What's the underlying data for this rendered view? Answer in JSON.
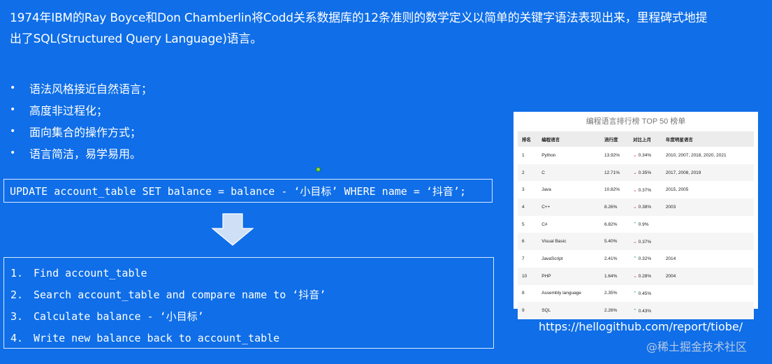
{
  "intro": {
    "line1": "1974年IBM的Ray Boyce和Don Chamberlin将Codd关系数据库的12条准则的数学定义以简单的关键字语法表现出来，里程碑式地提",
    "line2": "出了SQL(Structured Query Language)语言。"
  },
  "bullets": [
    "语法风格接近自然语言；",
    "高度非过程化；",
    "面向集合的操作方式；",
    "语言简洁，易学易用。"
  ],
  "sql_statement": "UPDATE account_table SET balance = balance - ‘小目标’ WHERE name = ‘抖音’;",
  "steps": [
    {
      "num": "1.",
      "text": "Find account_table"
    },
    {
      "num": "2.",
      "text": "Search account_table and compare name to ‘抖音’"
    },
    {
      "num": "3.",
      "text": "Calculate balance - ‘小目标’"
    },
    {
      "num": "4.",
      "text": "Write new balance back to account_table"
    }
  ],
  "tiobe": {
    "title": "编程语言排行榜 TOP 50 榜单",
    "headers": [
      "排名",
      "编程语言",
      "流行度",
      "对比上月",
      "年度明星语言"
    ],
    "rows": [
      {
        "rank": "1",
        "lang": "Python",
        "pop": "13.92%",
        "dir": "down",
        "chg": "0.34%",
        "star": "2010, 2007, 2018, 2020, 2021"
      },
      {
        "rank": "2",
        "lang": "C",
        "pop": "12.71%",
        "dir": "down",
        "chg": "0.35%",
        "star": "2017, 2008, 2019"
      },
      {
        "rank": "3",
        "lang": "Java",
        "pop": "10.82%",
        "dir": "down",
        "chg": "0.37%",
        "star": "2015, 2005"
      },
      {
        "rank": "4",
        "lang": "C++",
        "pop": "8.26%",
        "dir": "down",
        "chg": "0.38%",
        "star": "2003"
      },
      {
        "rank": "5",
        "lang": "C#",
        "pop": "6.82%",
        "dir": "up",
        "chg": "0.9%",
        "star": ""
      },
      {
        "rank": "6",
        "lang": "Visual Basic",
        "pop": "5.40%",
        "dir": "down",
        "chg": "0.37%",
        "star": ""
      },
      {
        "rank": "7",
        "lang": "JavaScript",
        "pop": "2.41%",
        "dir": "up",
        "chg": "0.32%",
        "star": "2014"
      },
      {
        "rank": "10",
        "lang": "PHP",
        "pop": "1.64%",
        "dir": "down",
        "chg": "0.28%",
        "star": "2004"
      },
      {
        "rank": "8",
        "lang": "Assembly language",
        "pop": "2.35%",
        "dir": "up",
        "chg": "0.45%",
        "star": ""
      },
      {
        "rank": "9",
        "lang": "SQL",
        "pop": "2.26%",
        "dir": "up",
        "chg": "0.43%",
        "star": ""
      }
    ]
  },
  "source_url": "https://hellogithub.com/report/tiobe/",
  "watermark": "@稀土掘金技术社区"
}
